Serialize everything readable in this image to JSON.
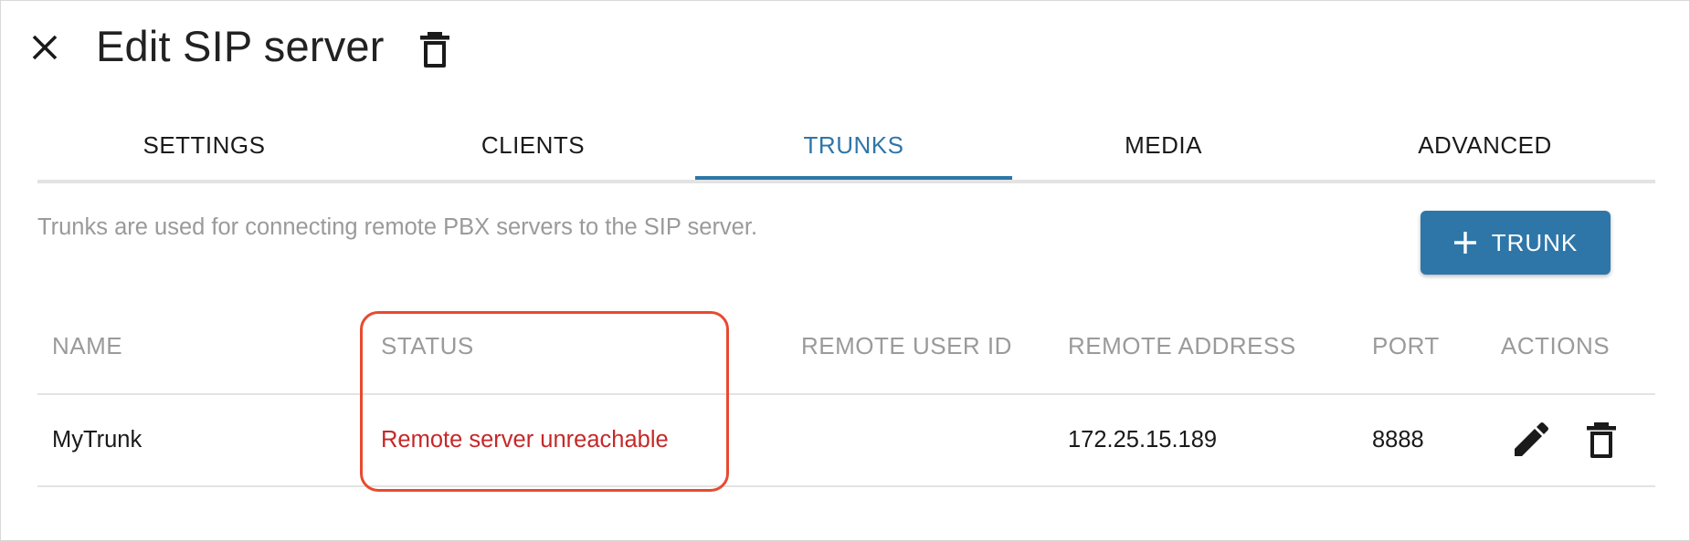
{
  "dialog": {
    "title": "Edit SIP server"
  },
  "tabs": [
    {
      "label": "SETTINGS",
      "active": false
    },
    {
      "label": "CLIENTS",
      "active": false
    },
    {
      "label": "TRUNKS",
      "active": true
    },
    {
      "label": "MEDIA",
      "active": false
    },
    {
      "label": "ADVANCED",
      "active": false
    }
  ],
  "trunks": {
    "helper_text": "Trunks are used for connecting remote PBX servers to the SIP server.",
    "add_button_label": "TRUNK",
    "columns": [
      "NAME",
      "STATUS",
      "REMOTE USER ID",
      "REMOTE ADDRESS",
      "PORT",
      "ACTIONS"
    ],
    "rows": [
      {
        "name": "MyTrunk",
        "status": "Remote server unreachable",
        "remote_user_id": "",
        "remote_address": "172.25.15.189",
        "port": "8888"
      }
    ]
  },
  "icons": {
    "close": "close-icon",
    "delete": "trash-icon",
    "add": "plus-icon",
    "edit": "pencil-icon"
  },
  "colors": {
    "accent": "#2e76a8",
    "status_error": "#c62828",
    "highlight_outline": "#e84a2f",
    "muted_text": "#9a9a9a"
  }
}
